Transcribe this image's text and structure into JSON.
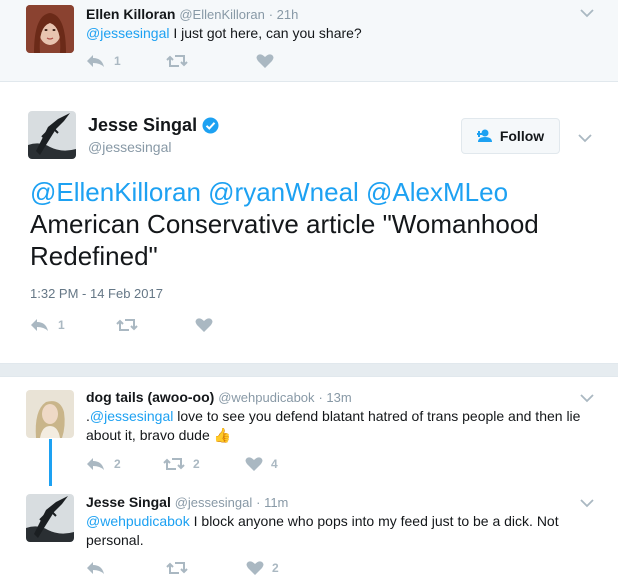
{
  "top_reply": {
    "name": "Ellen Killoran",
    "handle": "@EllenKilloran",
    "time": "· 21h",
    "mention": "@jessesingal",
    "text": " I just got here, can you share?",
    "reply_count": "1",
    "retweet_count": "",
    "like_count": ""
  },
  "main_tweet": {
    "name": "Jesse Singal",
    "handle": "@jessesingal",
    "follow_label": "Follow",
    "mentions": "@EllenKilloran @ryanWneal @AlexMLeo",
    "text": "American Conservative article \"Womanhood Redefined\"",
    "timestamp": "1:32 PM - 14 Feb 2017",
    "reply_count": "1",
    "retweet_count": "",
    "like_count": ""
  },
  "reply1": {
    "name": "dog tails (awoo-oo)",
    "handle": "@wehpudicabok",
    "time": "· 13m",
    "prefix": ".",
    "mention": "@jessesingal",
    "text": " love to see you defend blatant hatred of trans people and then lie about it, bravo dude ",
    "emoji": "👍",
    "reply_count": "2",
    "retweet_count": "2",
    "like_count": "4"
  },
  "reply2": {
    "name": "Jesse Singal",
    "handle": "@jessesingal",
    "time": "· 11m",
    "mention": "@wehpudicabok",
    "text": " I block anyone who pops into my feed just to be a dick. Not personal.",
    "reply_count": "",
    "retweet_count": "",
    "like_count": "2"
  },
  "colors": {
    "link": "#1da1f2",
    "icon": "#aab8c2",
    "verified": "#1da1f2",
    "thread_line": "#1da1f2"
  }
}
